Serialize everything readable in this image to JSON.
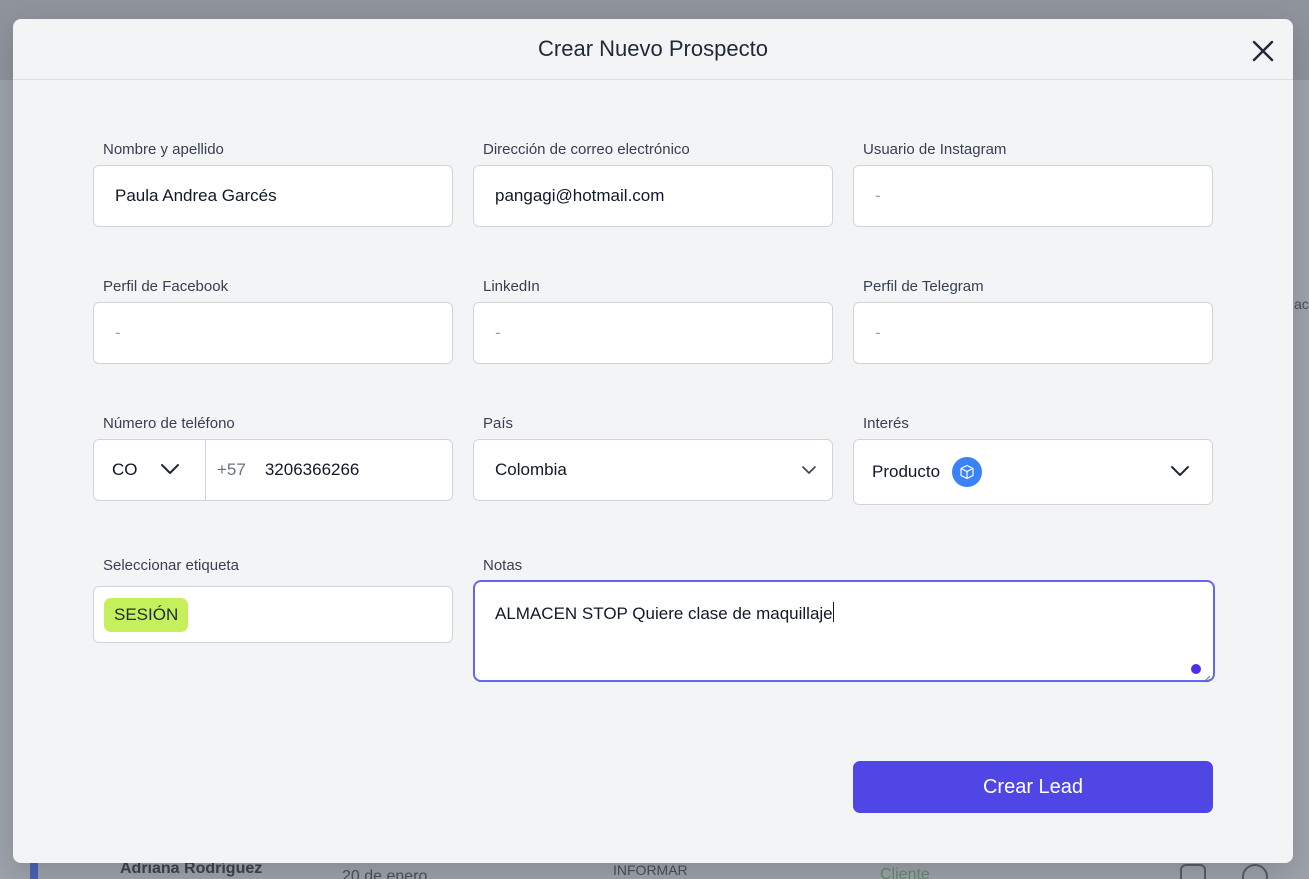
{
  "background": {
    "row_name": "Adriana Rodríguez",
    "row_date": "20 de enero",
    "row_status": "INFORMAR",
    "row_client": "Cliente",
    "right_edge_text": "ac"
  },
  "modal": {
    "title": "Crear Nuevo Prospecto",
    "close_icon": "close-icon"
  },
  "fields": {
    "name": {
      "label": "Nombre y apellido",
      "value": "Paula Andrea Garcés"
    },
    "email": {
      "label": "Dirección de correo electrónico",
      "value": "pangagi@hotmail.com"
    },
    "instagram": {
      "label": "Usuario de Instagram",
      "placeholder": "-"
    },
    "facebook": {
      "label": "Perfil de Facebook",
      "placeholder": "-"
    },
    "linkedin": {
      "label": "LinkedIn",
      "placeholder": "-"
    },
    "telegram": {
      "label": "Perfil de Telegram",
      "placeholder": "-"
    },
    "phone": {
      "label": "Número de teléfono",
      "country": "CO",
      "prefix": "+57",
      "number": "3206366266"
    },
    "country": {
      "label": "País",
      "value": "Colombia"
    },
    "interest": {
      "label": "Interés",
      "value": "Producto",
      "icon": "box-icon",
      "icon_color": "#3b82f6"
    },
    "tag": {
      "label": "Seleccionar etiqueta",
      "chip": "SESIÓN",
      "chip_color": "#c6f05b"
    },
    "notes": {
      "label": "Notas",
      "value": "ALMACEN STOP Quiere clase de maquillaje"
    }
  },
  "submit": {
    "label": "Crear Lead",
    "color": "#4f46e5"
  }
}
